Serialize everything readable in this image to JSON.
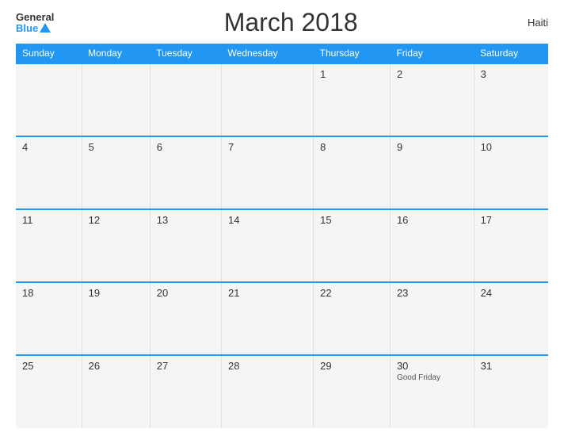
{
  "header": {
    "logo_general": "General",
    "logo_blue": "Blue",
    "title": "March 2018",
    "country": "Haiti"
  },
  "days_of_week": [
    "Sunday",
    "Monday",
    "Tuesday",
    "Wednesday",
    "Thursday",
    "Friday",
    "Saturday"
  ],
  "weeks": [
    [
      {
        "day": "",
        "event": ""
      },
      {
        "day": "",
        "event": ""
      },
      {
        "day": "",
        "event": ""
      },
      {
        "day": "",
        "event": ""
      },
      {
        "day": "1",
        "event": ""
      },
      {
        "day": "2",
        "event": ""
      },
      {
        "day": "3",
        "event": ""
      }
    ],
    [
      {
        "day": "4",
        "event": ""
      },
      {
        "day": "5",
        "event": ""
      },
      {
        "day": "6",
        "event": ""
      },
      {
        "day": "7",
        "event": ""
      },
      {
        "day": "8",
        "event": ""
      },
      {
        "day": "9",
        "event": ""
      },
      {
        "day": "10",
        "event": ""
      }
    ],
    [
      {
        "day": "11",
        "event": ""
      },
      {
        "day": "12",
        "event": ""
      },
      {
        "day": "13",
        "event": ""
      },
      {
        "day": "14",
        "event": ""
      },
      {
        "day": "15",
        "event": ""
      },
      {
        "day": "16",
        "event": ""
      },
      {
        "day": "17",
        "event": ""
      }
    ],
    [
      {
        "day": "18",
        "event": ""
      },
      {
        "day": "19",
        "event": ""
      },
      {
        "day": "20",
        "event": ""
      },
      {
        "day": "21",
        "event": ""
      },
      {
        "day": "22",
        "event": ""
      },
      {
        "day": "23",
        "event": ""
      },
      {
        "day": "24",
        "event": ""
      }
    ],
    [
      {
        "day": "25",
        "event": ""
      },
      {
        "day": "26",
        "event": ""
      },
      {
        "day": "27",
        "event": ""
      },
      {
        "day": "28",
        "event": ""
      },
      {
        "day": "29",
        "event": ""
      },
      {
        "day": "30",
        "event": "Good Friday"
      },
      {
        "day": "31",
        "event": ""
      }
    ]
  ]
}
